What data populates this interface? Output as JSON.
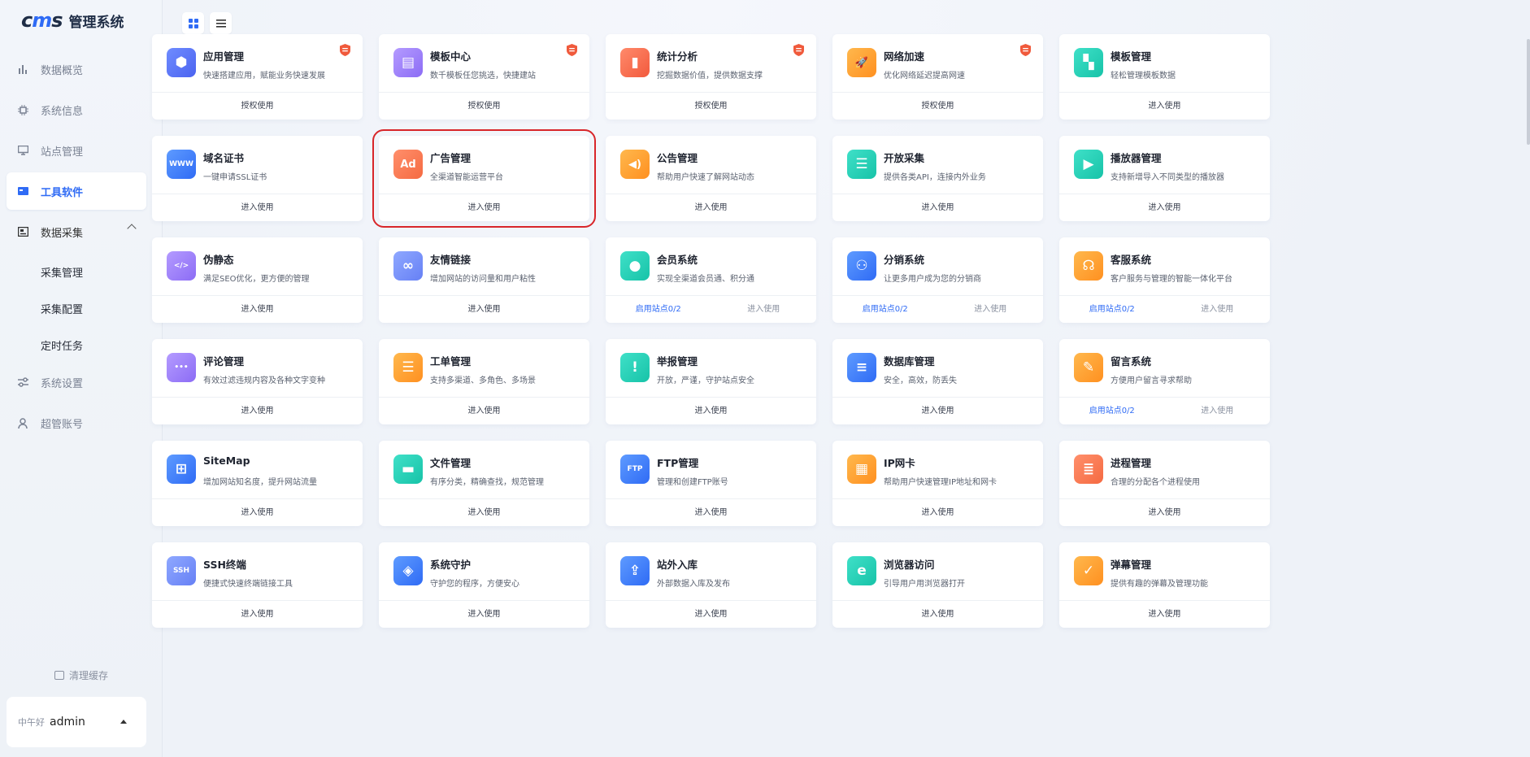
{
  "logo": {
    "mark": "cms",
    "title": "管理系统"
  },
  "nav": [
    {
      "label": "数据概览",
      "icon": "bar-chart-icon",
      "state": "normal"
    },
    {
      "label": "系统信息",
      "icon": "chip-icon",
      "state": "normal"
    },
    {
      "label": "站点管理",
      "icon": "monitor-icon",
      "state": "normal"
    },
    {
      "label": "工具软件",
      "icon": "toolbox-icon",
      "state": "active"
    },
    {
      "label": "数据采集",
      "icon": "collect-icon",
      "state": "group"
    }
  ],
  "sub_nav": [
    "采集管理",
    "采集配置",
    "定时任务"
  ],
  "nav2": [
    {
      "label": "系统设置",
      "icon": "settings-sliders-icon"
    },
    {
      "label": "超管账号",
      "icon": "user-icon"
    }
  ],
  "clear_cache": "清理缓存",
  "user": {
    "greeting": "中午好",
    "name": "admin"
  },
  "cards": [
    {
      "title": "应用管理",
      "desc": "快速搭建应用，赋能业务快速发展",
      "icon": "cubes-icon",
      "color": [
        "#6f8cff",
        "#4b63f0"
      ],
      "badge": true,
      "actions": [
        {
          "label": "授权使用",
          "style": "normal"
        }
      ]
    },
    {
      "title": "模板中心",
      "desc": "数千模板任您挑选，快捷建站",
      "icon": "layout-icon",
      "color": [
        "#b49bff",
        "#8c6cf5"
      ],
      "badge": true,
      "actions": [
        {
          "label": "授权使用",
          "style": "normal"
        }
      ]
    },
    {
      "title": "统计分析",
      "desc": "挖掘数据价值，提供数据支撑",
      "icon": "stats-icon",
      "color": [
        "#ff8a6b",
        "#f25a3d"
      ],
      "badge": true,
      "actions": [
        {
          "label": "授权使用",
          "style": "normal"
        }
      ]
    },
    {
      "title": "网络加速",
      "desc": "优化网络延迟提高网速",
      "icon": "rocket-icon",
      "color": [
        "#ffb84d",
        "#ff9020"
      ],
      "badge": true,
      "actions": [
        {
          "label": "授权使用",
          "style": "normal"
        }
      ]
    },
    {
      "title": "模板管理",
      "desc": "轻松管理模板数据",
      "icon": "template-icon",
      "color": [
        "#3fe0c8",
        "#17c3a8"
      ],
      "badge": false,
      "actions": [
        {
          "label": "进入使用",
          "style": "normal"
        }
      ]
    },
    {
      "title": "域名证书",
      "desc": "一键申请SSL证书",
      "icon": "www-icon",
      "color": [
        "#5e9bff",
        "#2f6bf5"
      ],
      "badge": false,
      "actions": [
        {
          "label": "进入使用",
          "style": "normal"
        }
      ]
    },
    {
      "title": "广告管理",
      "desc": "全渠道智能运营平台",
      "icon": "ad-icon",
      "color": [
        "#ff8f6b",
        "#f56a42"
      ],
      "badge": false,
      "selected": true,
      "actions": [
        {
          "label": "进入使用",
          "style": "normal"
        }
      ]
    },
    {
      "title": "公告管理",
      "desc": "帮助用户快速了解网站动态",
      "icon": "speaker-icon",
      "color": [
        "#ffb84d",
        "#ff9020"
      ],
      "badge": false,
      "actions": [
        {
          "label": "进入使用",
          "style": "normal"
        }
      ]
    },
    {
      "title": "开放采集",
      "desc": "提供各类API，连接内外业务",
      "icon": "server-icon",
      "color": [
        "#3fe0c8",
        "#17c3a8"
      ],
      "badge": false,
      "actions": [
        {
          "label": "进入使用",
          "style": "normal"
        }
      ]
    },
    {
      "title": "播放器管理",
      "desc": "支持新增导入不同类型的播放器",
      "icon": "play-icon",
      "color": [
        "#3fe0c8",
        "#17c3a8"
      ],
      "badge": false,
      "actions": [
        {
          "label": "进入使用",
          "style": "normal"
        }
      ]
    },
    {
      "title": "伪静态",
      "desc": "满足SEO优化，更方便的管理",
      "icon": "code-window-icon",
      "color": [
        "#b49bff",
        "#8c6cf5"
      ],
      "badge": false,
      "actions": [
        {
          "label": "进入使用",
          "style": "normal"
        }
      ]
    },
    {
      "title": "友情链接",
      "desc": "增加网站的访问量和用户粘性",
      "icon": "link-icon",
      "color": [
        "#8fa8ff",
        "#6680f5"
      ],
      "badge": false,
      "actions": [
        {
          "label": "进入使用",
          "style": "normal"
        }
      ]
    },
    {
      "title": "会员系统",
      "desc": "实现全渠道会员通、积分通",
      "icon": "member-icon",
      "color": [
        "#3fe0c8",
        "#17c3a8"
      ],
      "badge": false,
      "actions": [
        {
          "label": "启用站点0/2",
          "style": "link"
        },
        {
          "label": "进入使用",
          "style": "muted"
        }
      ]
    },
    {
      "title": "分销系统",
      "desc": "让更多用户成为您的分销商",
      "icon": "team-icon",
      "color": [
        "#5e9bff",
        "#2f6bf5"
      ],
      "badge": false,
      "actions": [
        {
          "label": "启用站点0/2",
          "style": "link"
        },
        {
          "label": "进入使用",
          "style": "muted"
        }
      ]
    },
    {
      "title": "客服系统",
      "desc": "客户服务与管理的智能一体化平台",
      "icon": "headset-icon",
      "color": [
        "#ffb84d",
        "#ff9020"
      ],
      "badge": false,
      "actions": [
        {
          "label": "启用站点0/2",
          "style": "link"
        },
        {
          "label": "进入使用",
          "style": "muted"
        }
      ]
    },
    {
      "title": "评论管理",
      "desc": "有效过滤违规内容及各种文字变种",
      "icon": "chat-icon",
      "color": [
        "#b49bff",
        "#8c6cf5"
      ],
      "badge": false,
      "actions": [
        {
          "label": "进入使用",
          "style": "normal"
        }
      ]
    },
    {
      "title": "工单管理",
      "desc": "支持多渠道、多角色、多场景",
      "icon": "clipboard-icon",
      "color": [
        "#ffb84d",
        "#ff9020"
      ],
      "badge": false,
      "actions": [
        {
          "label": "进入使用",
          "style": "normal"
        }
      ]
    },
    {
      "title": "举报管理",
      "desc": "开放，严谨，守护站点安全",
      "icon": "warning-icon",
      "color": [
        "#3fe0c8",
        "#17c3a8"
      ],
      "badge": false,
      "actions": [
        {
          "label": "进入使用",
          "style": "normal"
        }
      ]
    },
    {
      "title": "数据库管理",
      "desc": "安全，高效，防丢失",
      "icon": "database-icon",
      "color": [
        "#5e9bff",
        "#2f6bf5"
      ],
      "badge": false,
      "actions": [
        {
          "label": "进入使用",
          "style": "normal"
        }
      ]
    },
    {
      "title": "留言系统",
      "desc": "方便用户留言寻求帮助",
      "icon": "message-icon",
      "color": [
        "#ffb84d",
        "#ff9020"
      ],
      "badge": false,
      "actions": [
        {
          "label": "启用站点0/2",
          "style": "link"
        },
        {
          "label": "进入使用",
          "style": "muted"
        }
      ]
    },
    {
      "title": "SiteMap",
      "desc": "增加网站知名度，提升网站流量",
      "icon": "sitemap-icon",
      "color": [
        "#5e9bff",
        "#2f6bf5"
      ],
      "badge": false,
      "actions": [
        {
          "label": "进入使用",
          "style": "normal"
        }
      ]
    },
    {
      "title": "文件管理",
      "desc": "有序分类，精确查找，规范管理",
      "icon": "folder-icon",
      "color": [
        "#3fe0c8",
        "#17c3a8"
      ],
      "badge": false,
      "actions": [
        {
          "label": "进入使用",
          "style": "normal"
        }
      ]
    },
    {
      "title": "FTP管理",
      "desc": "管理和创建FTP账号",
      "icon": "ftp-icon",
      "color": [
        "#5e9bff",
        "#2f6bf5"
      ],
      "badge": false,
      "actions": [
        {
          "label": "进入使用",
          "style": "normal"
        }
      ]
    },
    {
      "title": "IP网卡",
      "desc": "帮助用户快速管理IP地址和网卡",
      "icon": "network-card-icon",
      "color": [
        "#ffb84d",
        "#ff9020"
      ],
      "badge": false,
      "actions": [
        {
          "label": "进入使用",
          "style": "normal"
        }
      ]
    },
    {
      "title": "进程管理",
      "desc": "合理的分配各个进程使用",
      "icon": "process-icon",
      "color": [
        "#ff8f6b",
        "#f56a42"
      ],
      "badge": false,
      "actions": [
        {
          "label": "进入使用",
          "style": "normal"
        }
      ]
    },
    {
      "title": "SSH终端",
      "desc": "便捷式快速终端链接工具",
      "icon": "ssh-icon",
      "color": [
        "#8fa8ff",
        "#6680f5"
      ],
      "badge": false,
      "actions": [
        {
          "label": "进入使用",
          "style": "normal"
        }
      ]
    },
    {
      "title": "系统守护",
      "desc": "守护您的程序，方便安心",
      "icon": "shield-server-icon",
      "color": [
        "#5e9bff",
        "#2f6bf5"
      ],
      "badge": false,
      "actions": [
        {
          "label": "进入使用",
          "style": "normal"
        }
      ]
    },
    {
      "title": "站外入库",
      "desc": "外部数据入库及发布",
      "icon": "import-doc-icon",
      "color": [
        "#5e9bff",
        "#2f6bf5"
      ],
      "badge": false,
      "actions": [
        {
          "label": "进入使用",
          "style": "normal"
        }
      ]
    },
    {
      "title": "浏览器访问",
      "desc": "引导用户用浏览器打开",
      "icon": "browser-icon",
      "color": [
        "#3fe0c8",
        "#17c3a8"
      ],
      "badge": false,
      "actions": [
        {
          "label": "进入使用",
          "style": "normal"
        }
      ]
    },
    {
      "title": "弹幕管理",
      "desc": "提供有趣的弹幕及管理功能",
      "icon": "barrage-icon",
      "color": [
        "#ffb84d",
        "#ff9020"
      ],
      "badge": false,
      "actions": [
        {
          "label": "进入使用",
          "style": "normal"
        }
      ]
    }
  ]
}
